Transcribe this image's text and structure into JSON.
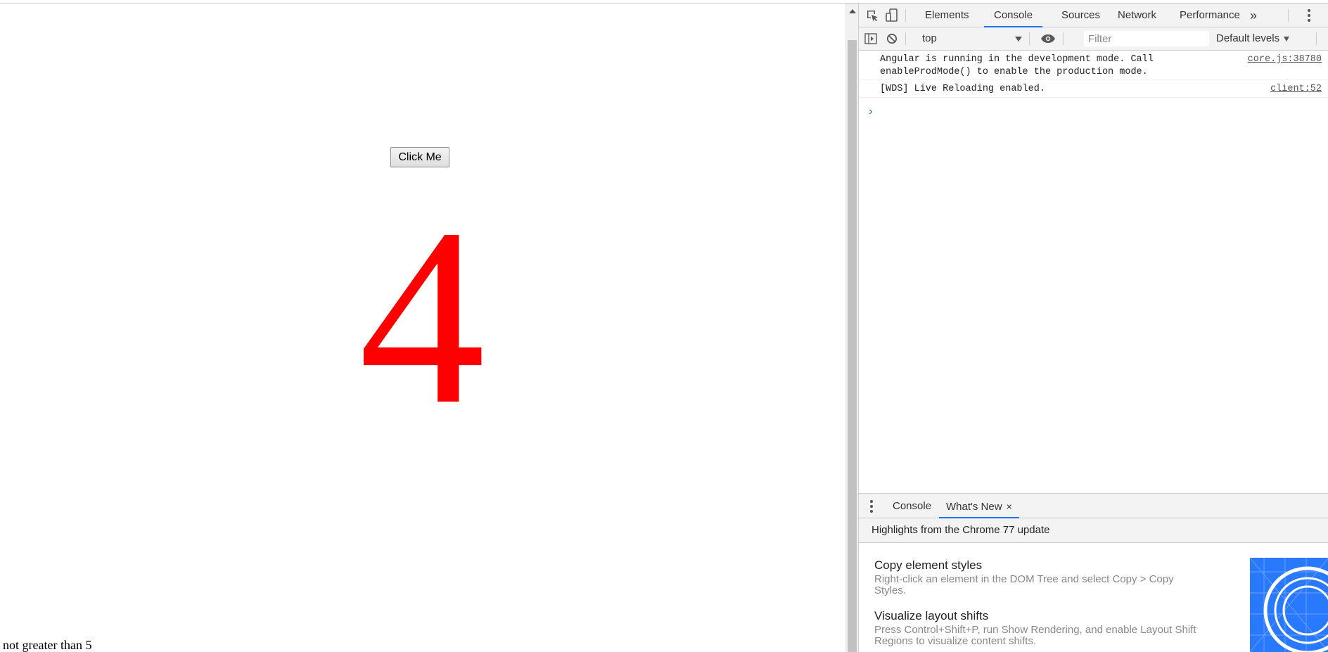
{
  "page": {
    "button_label": "Click Me",
    "count_value": "4",
    "status_message": "not greater than 5"
  },
  "devtools": {
    "tabs": [
      "Elements",
      "Console",
      "Sources",
      "Network",
      "Performance"
    ],
    "active_tab": "Console",
    "more_tabs_glyph": "»",
    "toolbar": {
      "context": "top",
      "filter_placeholder": "Filter",
      "levels": "Default levels"
    },
    "messages": [
      {
        "text": "Angular is running in the development mode. Call enableProdMode() to enable the production mode.",
        "source": "core.js:38780"
      },
      {
        "text": "[WDS] Live Reloading enabled.",
        "source": "client:52"
      }
    ],
    "prompt_glyph": "›",
    "drawer": {
      "tabs": [
        "Console",
        "What's New"
      ],
      "active_tab": "What's New",
      "close_glyph": "×",
      "highlights": "Highlights from the Chrome 77 update",
      "items": [
        {
          "title": "Copy element styles",
          "description": "Right-click an element in the DOM Tree and select Copy > Copy Styles."
        },
        {
          "title": "Visualize layout shifts",
          "description": "Press Control+Shift+P, run Show Rendering, and enable Layout Shift Regions to visualize content shifts."
        }
      ]
    }
  },
  "colors": {
    "count_color": "#ff0000",
    "accent": "#1a73e8"
  },
  "icons": [
    "inspect-element-icon",
    "device-toolbar-icon",
    "more-tabs-icon",
    "settings-menu-icon",
    "show-sidebar-icon",
    "clear-console-icon",
    "live-expression-eye-icon",
    "drawer-menu-icon",
    "close-icon"
  ]
}
